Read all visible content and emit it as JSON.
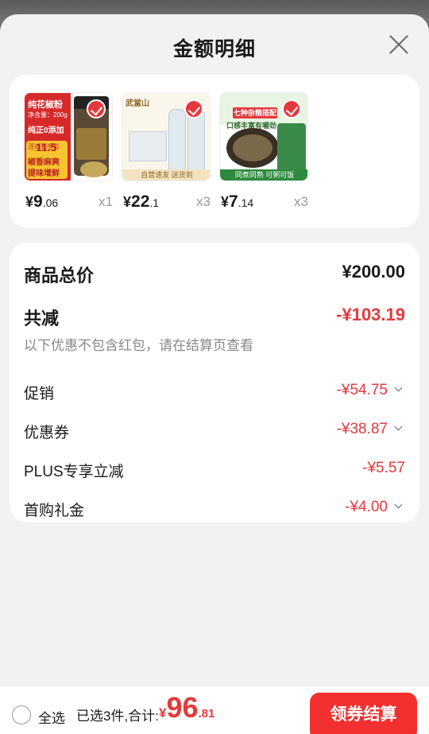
{
  "sheet": {
    "title": "金额明细"
  },
  "products": [
    {
      "price_yen": "¥",
      "price_int": "9",
      "price_dec": ".06",
      "quantity": "x1",
      "thumb": {
        "lines": [
          "纯花椒粉",
          "净含量：200g",
          "纯正0添加",
          "活动到手价",
          "椒香麻爽",
          "提味增鲜"
        ],
        "sub": "11.5"
      }
    },
    {
      "price_yen": "¥",
      "price_int": "22",
      "price_dec": ".1",
      "quantity": "x3",
      "thumb": {
        "brand": "武當山",
        "footer": "自营速发 送货到"
      }
    },
    {
      "price_yen": "¥",
      "price_int": "7",
      "price_dec": ".14",
      "quantity": "x3",
      "thumb": {
        "banner": "七种杂粮搭配",
        "tag": "口感丰富有嚼劲",
        "footer": "同煮同熟 可粥可饭"
      }
    }
  ],
  "summary": {
    "total_label": "商品总价",
    "total_value": "¥200.00",
    "reduce_label": "共减",
    "reduce_value": "-¥103.19",
    "note": "以下优惠不包含红包，请在结算页查看",
    "items": [
      {
        "label": "促销",
        "value": "-¥54.75",
        "expandable": true
      },
      {
        "label": "优惠券",
        "value": "-¥38.87",
        "expandable": true
      },
      {
        "label": "PLUS专享立减",
        "value": "-¥5.57",
        "expandable": false
      },
      {
        "label": "首购礼金",
        "value": "-¥4.00",
        "expandable": true
      }
    ]
  },
  "bottom_bar": {
    "select_all_label": "全选",
    "selected_total_label": "已选3件,合计:",
    "total_yen": "¥",
    "total_int": "96",
    "total_dec": ".81",
    "checkout_label": "领券结算"
  },
  "colors": {
    "accent": "#e4393c",
    "checkout_button": "#f23030"
  }
}
